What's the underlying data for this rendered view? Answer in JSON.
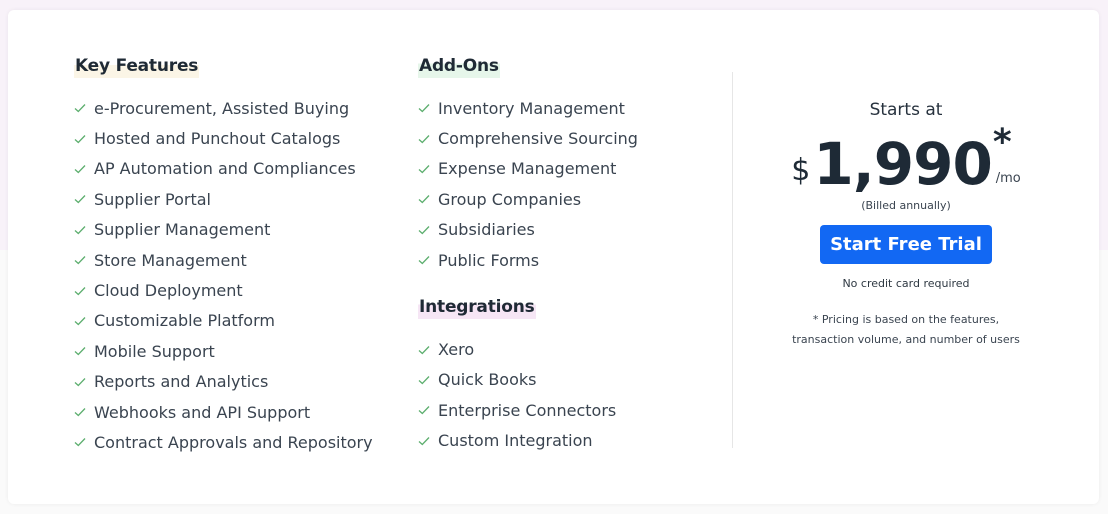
{
  "key_features": {
    "title": "Key Features",
    "items": [
      "e-Procurement, Assisted Buying",
      "Hosted and Punchout Catalogs",
      "AP Automation and Compliances",
      "Supplier Portal",
      "Supplier Management",
      "Store Management",
      "Cloud Deployment",
      "Customizable Platform",
      "Mobile Support",
      "Reports and Analytics",
      "Webhooks and API Support",
      "Contract Approvals and Repository"
    ]
  },
  "add_ons": {
    "title": "Add-Ons",
    "items": [
      "Inventory Management",
      "Comprehensive Sourcing",
      "Expense Management",
      "Group Companies",
      "Subsidiaries",
      "Public Forms"
    ]
  },
  "integrations": {
    "title": "Integrations",
    "items": [
      "Xero",
      "Quick Books",
      "Enterprise Connectors",
      "Custom Integration"
    ]
  },
  "pricing": {
    "starts_at": "Starts at",
    "currency": "$",
    "amount": "1,990",
    "asterisk": "*",
    "period": "/mo",
    "billing": "(Billed annually)",
    "cta_label": "Start Free Trial",
    "no_card": "No credit card required",
    "note_line1": "* Pricing is based on the features,",
    "note_line2": "transaction volume, and number of users"
  },
  "icons": {
    "list_bullet": "check-icon"
  },
  "colors": {
    "accent": "#1268f3",
    "check": "#5cae6e",
    "text_dark": "#1e2a36"
  }
}
